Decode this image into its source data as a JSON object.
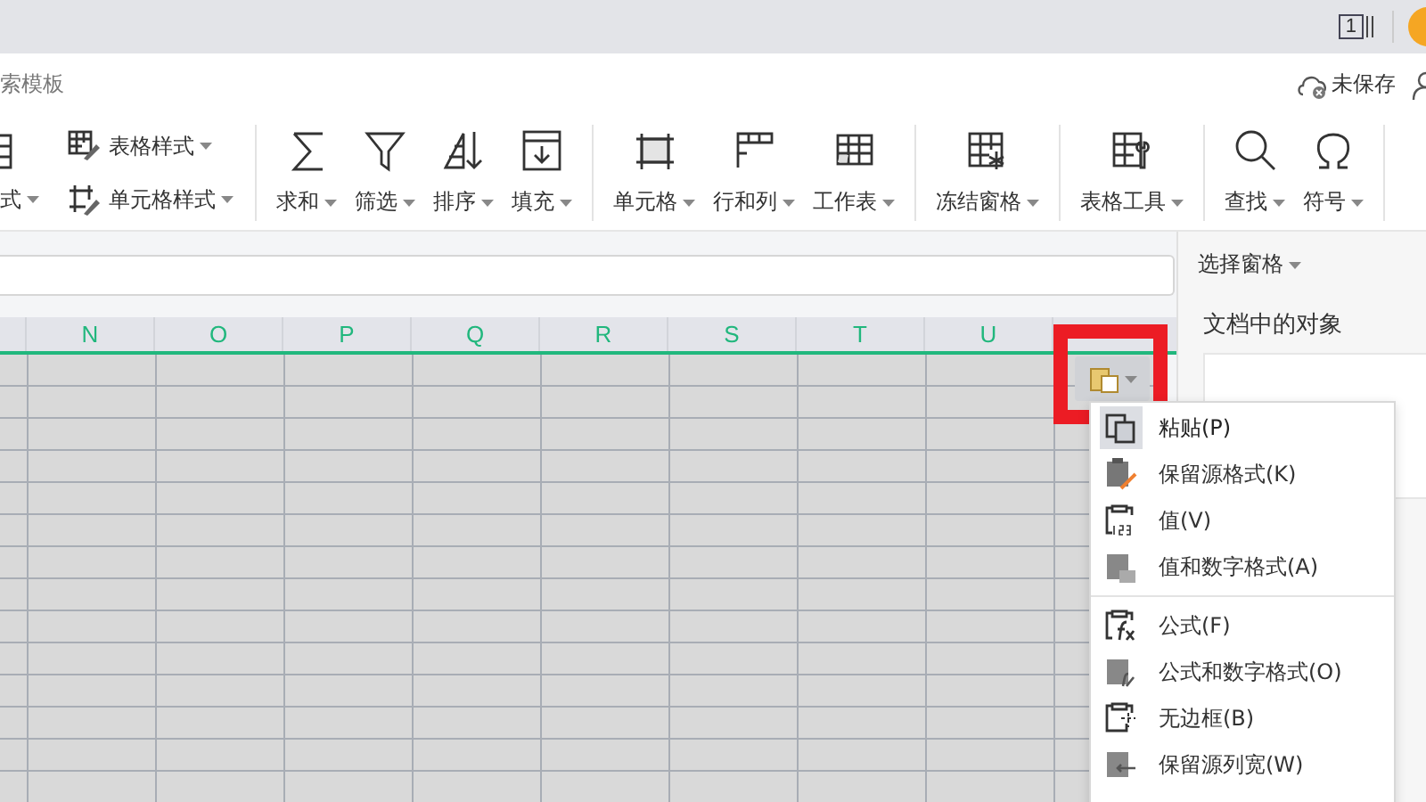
{
  "top_bar": {
    "window_count": "1"
  },
  "tab_row": {
    "search_hint": "索模板",
    "save_status": "未保存"
  },
  "toolbar": {
    "cut_label": "式",
    "style_items": [
      {
        "label": "表格样式",
        "kind": "table-style"
      },
      {
        "label": "单元格样式",
        "kind": "cell-style"
      }
    ],
    "groups": [
      [
        {
          "label": "求和",
          "kind": "sigma"
        },
        {
          "label": "筛选",
          "kind": "funnel"
        },
        {
          "label": "排序",
          "kind": "sort"
        },
        {
          "label": "填充",
          "kind": "fill"
        }
      ],
      [
        {
          "label": "单元格",
          "kind": "cell"
        },
        {
          "label": "行和列",
          "kind": "rowcol"
        },
        {
          "label": "工作表",
          "kind": "sheet"
        }
      ],
      [
        {
          "label": "冻结窗格",
          "kind": "freeze"
        }
      ],
      [
        {
          "label": "表格工具",
          "kind": "tools"
        }
      ],
      [
        {
          "label": "查找",
          "kind": "search"
        },
        {
          "label": "符号",
          "kind": "omega"
        }
      ]
    ]
  },
  "sheet": {
    "columns": [
      "N",
      "O",
      "P",
      "Q",
      "R",
      "S",
      "T",
      "U"
    ]
  },
  "paste_button": {
    "highlighted": true
  },
  "paste_menu": {
    "items": [
      {
        "label": "粘贴(P)",
        "kind": "paste",
        "selected": true,
        "divider_before": false
      },
      {
        "label": "保留源格式(K)",
        "kind": "keep-format",
        "selected": false,
        "divider_before": false
      },
      {
        "label": "值(V)",
        "kind": "values",
        "selected": false,
        "divider_before": false
      },
      {
        "label": "值和数字格式(A)",
        "kind": "values-format",
        "selected": false,
        "divider_before": false
      },
      {
        "label": "公式(F)",
        "kind": "formula",
        "selected": false,
        "divider_before": true
      },
      {
        "label": "公式和数字格式(O)",
        "kind": "formula-format",
        "selected": false,
        "divider_before": false
      },
      {
        "label": "无边框(B)",
        "kind": "no-border",
        "selected": false,
        "divider_before": false
      },
      {
        "label": "保留源列宽(W)",
        "kind": "col-width",
        "selected": false,
        "divider_before": false
      }
    ]
  },
  "side_panel": {
    "title": "选择窗格",
    "heading": "文档中的对象"
  }
}
